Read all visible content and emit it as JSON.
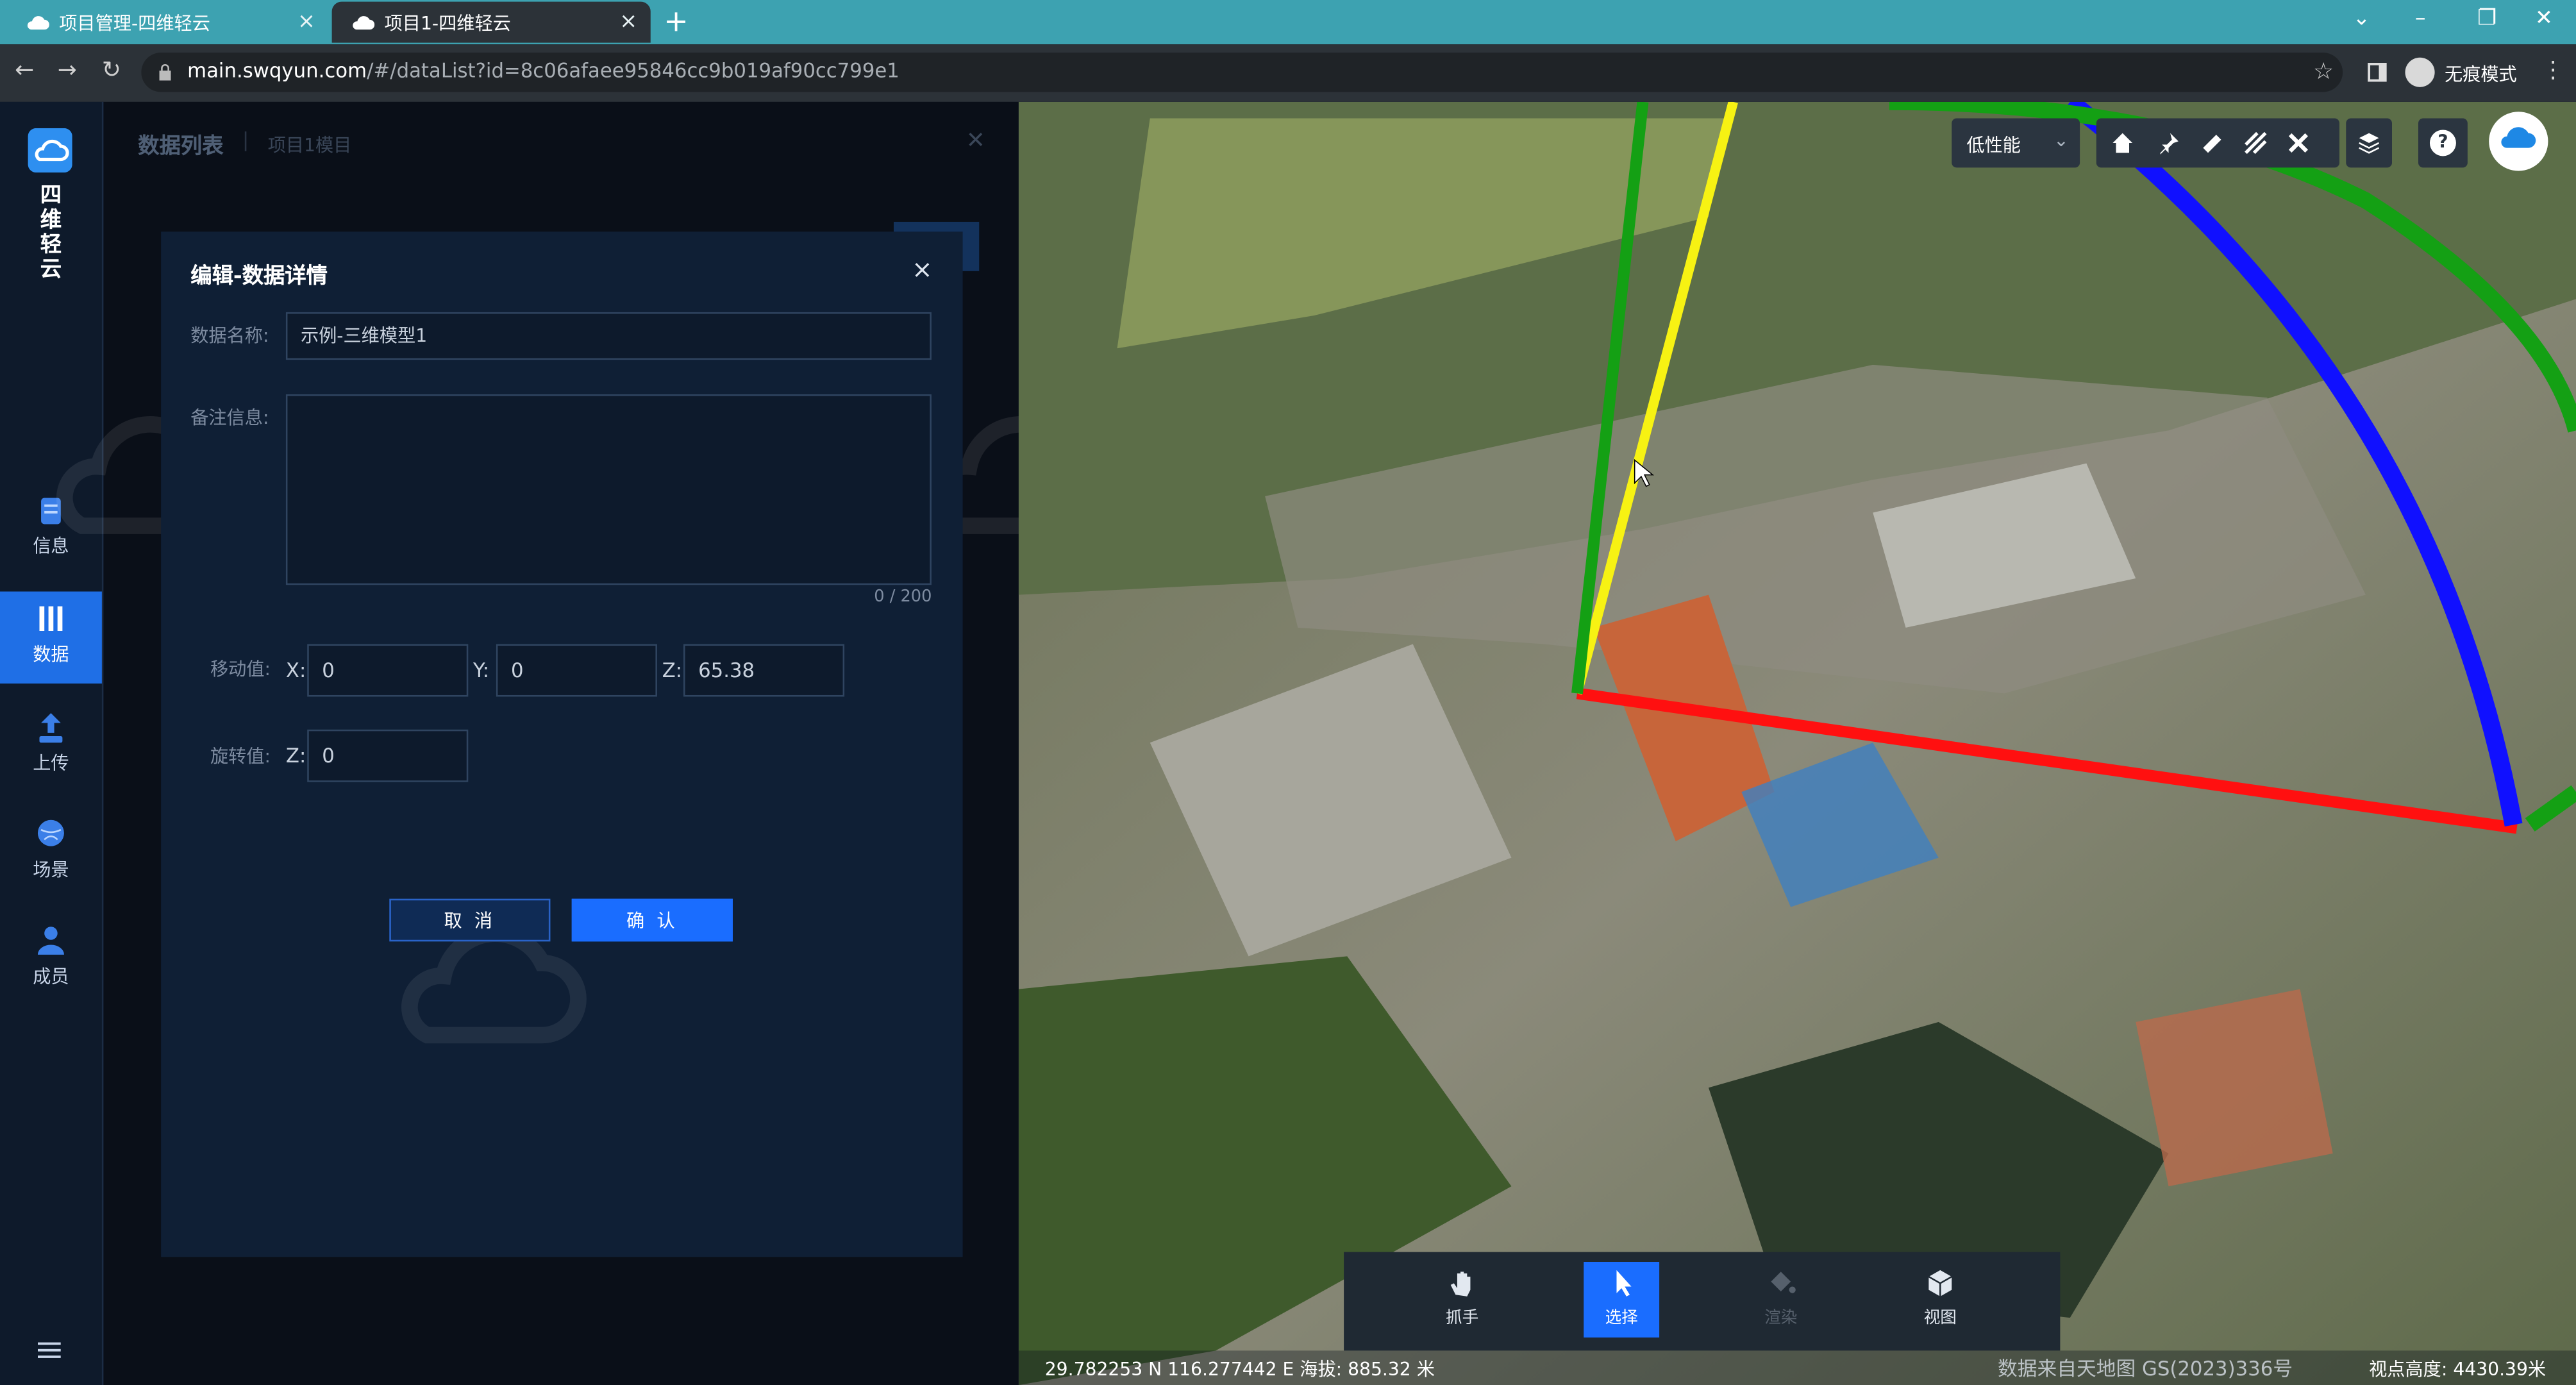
{
  "browser": {
    "tabs": [
      {
        "label": "项目管理-四维轻云"
      },
      {
        "label": "项目1-四维轻云"
      }
    ],
    "url_host": "main.swqyun.com",
    "url_path": "/#/dataList?id=8c06afaee95846cc9b019af90cc799e1",
    "profile_label": "无痕模式"
  },
  "rail": {
    "logo_text": "四\n维\n轻\n云",
    "items": [
      {
        "label": "信息",
        "icon": "document-icon"
      },
      {
        "label": "数据",
        "icon": "database-icon",
        "active": true
      },
      {
        "label": "上传",
        "icon": "upload-icon"
      },
      {
        "label": "场景",
        "icon": "globe-icon"
      },
      {
        "label": "成员",
        "icon": "users-icon"
      }
    ],
    "menu_icon": "menu-icon"
  },
  "panel": {
    "title": "数据列表",
    "subtitle": "项目1模目"
  },
  "dialog": {
    "title": "编辑-数据详情",
    "name_label": "数据名称:",
    "name_value": "示例-三维模型1",
    "note_label": "备注信息:",
    "note_value": "",
    "note_counter": "0 / 200",
    "move_label": "移动值:",
    "move_x_label": "X:",
    "move_x": "0",
    "move_y_label": "Y:",
    "move_y": "0",
    "move_z_label": "Z:",
    "move_z": "65.38",
    "rotate_label": "旋转值:",
    "rotate_z_label": "Z:",
    "rotate_z": "0",
    "cancel_label": "取 消",
    "confirm_label": "确 认"
  },
  "map": {
    "performance_label": "低性能",
    "tool_icons": [
      "home-icon",
      "pin-icon",
      "ruler-icon",
      "measure-area-icon",
      "tools-icon"
    ],
    "bottom_tools": [
      {
        "label": "抓手",
        "icon": "hand-icon",
        "active": false
      },
      {
        "label": "选择",
        "icon": "pointer-icon",
        "active": true
      },
      {
        "label": "渲染",
        "icon": "paint-bucket-icon",
        "active": false,
        "disabled": true
      },
      {
        "label": "视图",
        "icon": "cube-icon",
        "active": false
      }
    ],
    "coordinates": "29.782253 N 116.277442 E 海拔: 885.32 米",
    "source_text": "数据来自天地图 GS(2023)336号",
    "altitude_text": "视点高度: 4430.39米",
    "axis_colors": {
      "x": "#ff1010",
      "y": "#f7f213",
      "z": "#14a014",
      "ring_blue": "#1010ff",
      "ring_green": "#14a014"
    }
  }
}
